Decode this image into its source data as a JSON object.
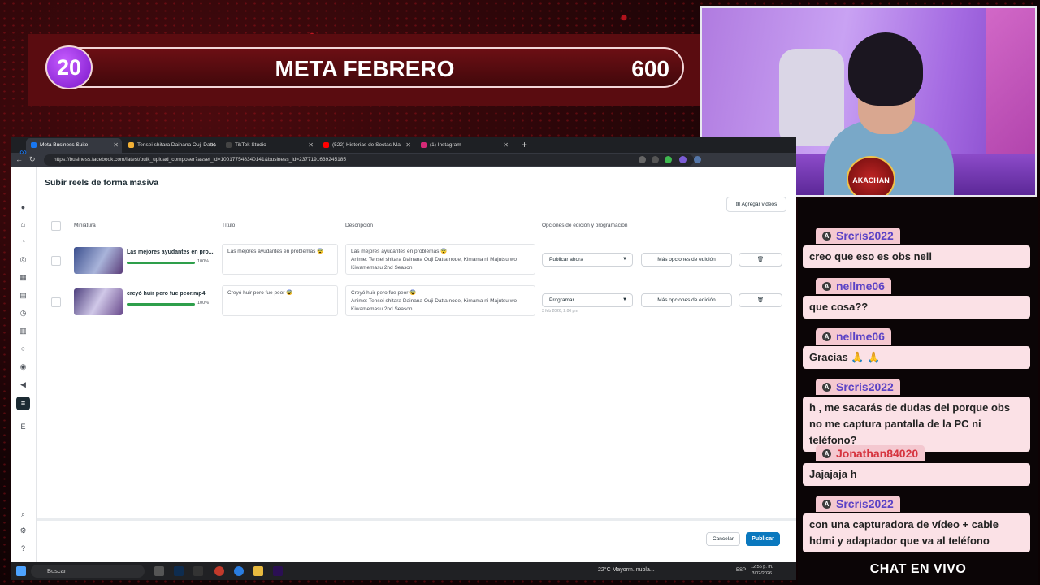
{
  "goal": {
    "current": "20",
    "title": "META FEBRERO",
    "target": "600"
  },
  "webcam": {
    "logo_text": "AKACHAN"
  },
  "browser": {
    "tabs": [
      {
        "label": "Meta Business Suite",
        "color": "#1877f2"
      },
      {
        "label": "Tensei shitara Dainana Ouji Datta",
        "color": "#f2b035"
      },
      {
        "label": "TikTok Studio",
        "color": "#111111"
      },
      {
        "label": "(522) Historias de Sectas Ma",
        "color": "#ff0000"
      },
      {
        "label": "(1) Instagram",
        "color": "#d62976"
      }
    ],
    "url": "https://business.facebook.com/latest/bulk_upload_composer?asset_id=100177548340141&business_id=2377191639245185"
  },
  "page": {
    "title": "Subir reels de forma masiva",
    "add_videos": "Agregar videos",
    "columns": {
      "thumbnail": "Miniatura",
      "title": "Título",
      "description": "Descripción",
      "options": "Opciones de edición y programación"
    },
    "rows": [
      {
        "filename": "Las mejores ayudantes en pro...",
        "progress": "100%",
        "title": "Las mejores ayudantes en problemas 😨",
        "description_line1": "Las mejores ayudantes en problemas 😨",
        "description_line2": "Anime: Tensei shitara Dainana Ouji Datta node, Kimama ni Majutsu wo Kiwamemasu 2nd Season",
        "publish_option": "Publicar ahora",
        "schedule": "",
        "more_options": "Más opciones de edición"
      },
      {
        "filename": "creyó huir pero fue peor.mp4",
        "progress": "100%",
        "title": "Creyó huir pero fue peor 😨",
        "description_line1": "Creyó huir pero fue peor 😨",
        "description_line2": "Anime: Tensei shitara Dainana Ouji Datta node, Kimama ni Majutsu wo Kiwamemasu 2nd Season",
        "publish_option": "Programar",
        "schedule": "3 feb 2026, 2:00 pm",
        "more_options": "Más opciones de edición"
      }
    ],
    "cancel": "Cancelar",
    "publish": "Publicar"
  },
  "taskbar": {
    "search": "Buscar",
    "weather": "22°C  Mayorm. nubla...",
    "lang": "ESP",
    "time": "12:56 p. m.",
    "date": "3/02/2026"
  },
  "chat": {
    "title": "CHAT EN VIVO",
    "messages": [
      {
        "user": "Srcris2022",
        "text": "creo que eso es obs nell"
      },
      {
        "user": "nellme06",
        "text": "que cosa??"
      },
      {
        "user": "nellme06",
        "text": "Gracias 🙏 🙏"
      },
      {
        "user": "Srcris2022",
        "text": "h , me sacarás de dudas del porque obs no me captura pantalla de la PC ni teléfono?"
      },
      {
        "user": "Jonathan84020",
        "text": "Jajajaja h"
      },
      {
        "user": "Srcris2022",
        "text": "con una capturadora de vídeo + cable hdmi y adaptador que va al teléfono"
      }
    ]
  }
}
